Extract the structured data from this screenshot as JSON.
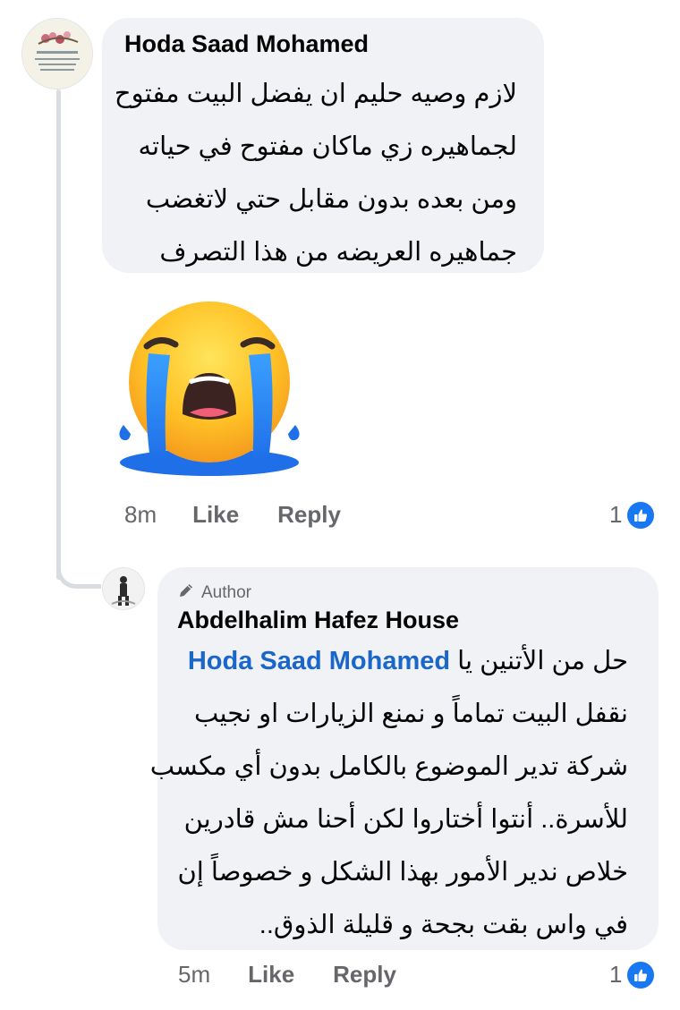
{
  "comment1": {
    "author": "Hoda Saad Mohamed",
    "text_lines": [
      "لازم وصيه حليم ان يفضل البيت مفتوح",
      "لجماهيره زي ماكان مفتوح في حياته",
      "ومن بعده بدون مقابل حتي لاتغضب",
      "جماهيره العريضه من هذا التصرف"
    ],
    "sticker": "crying-face-sticker",
    "time": "8m",
    "like_label": "Like",
    "reply_label": "Reply",
    "reaction_count": "1",
    "reaction_icon": "thumbs-up-icon"
  },
  "reply1": {
    "badge_label": "Author",
    "badge_icon": "pencil-icon",
    "author": "Abdelhalim Hafez House",
    "first_line_prefix": "حل من الأتنين يا",
    "mention": "Hoda Saad Mohamed",
    "text_lines": [
      "نقفل البيت تماماً و نمنع الزيارات او نجيب",
      "شركة تدير الموضوع بالكامل بدون أي مكسب",
      "للأسرة.. أنتوا أختاروا لكن أحنا مش قادرين",
      "خلاص ندير الأمور بهذا الشكل و خصوصاً إن",
      "في واس بقت بجحة و قليلة الذوق.."
    ],
    "time": "5m",
    "like_label": "Like",
    "reply_label": "Reply",
    "reaction_count": "1",
    "reaction_icon": "thumbs-up-icon"
  },
  "colors": {
    "bubble_bg": "#f0f2f5",
    "meta_text": "#65676b",
    "mention": "#1b66c9",
    "like_blue": "#1877f2",
    "thread_line": "#d9dce0"
  }
}
